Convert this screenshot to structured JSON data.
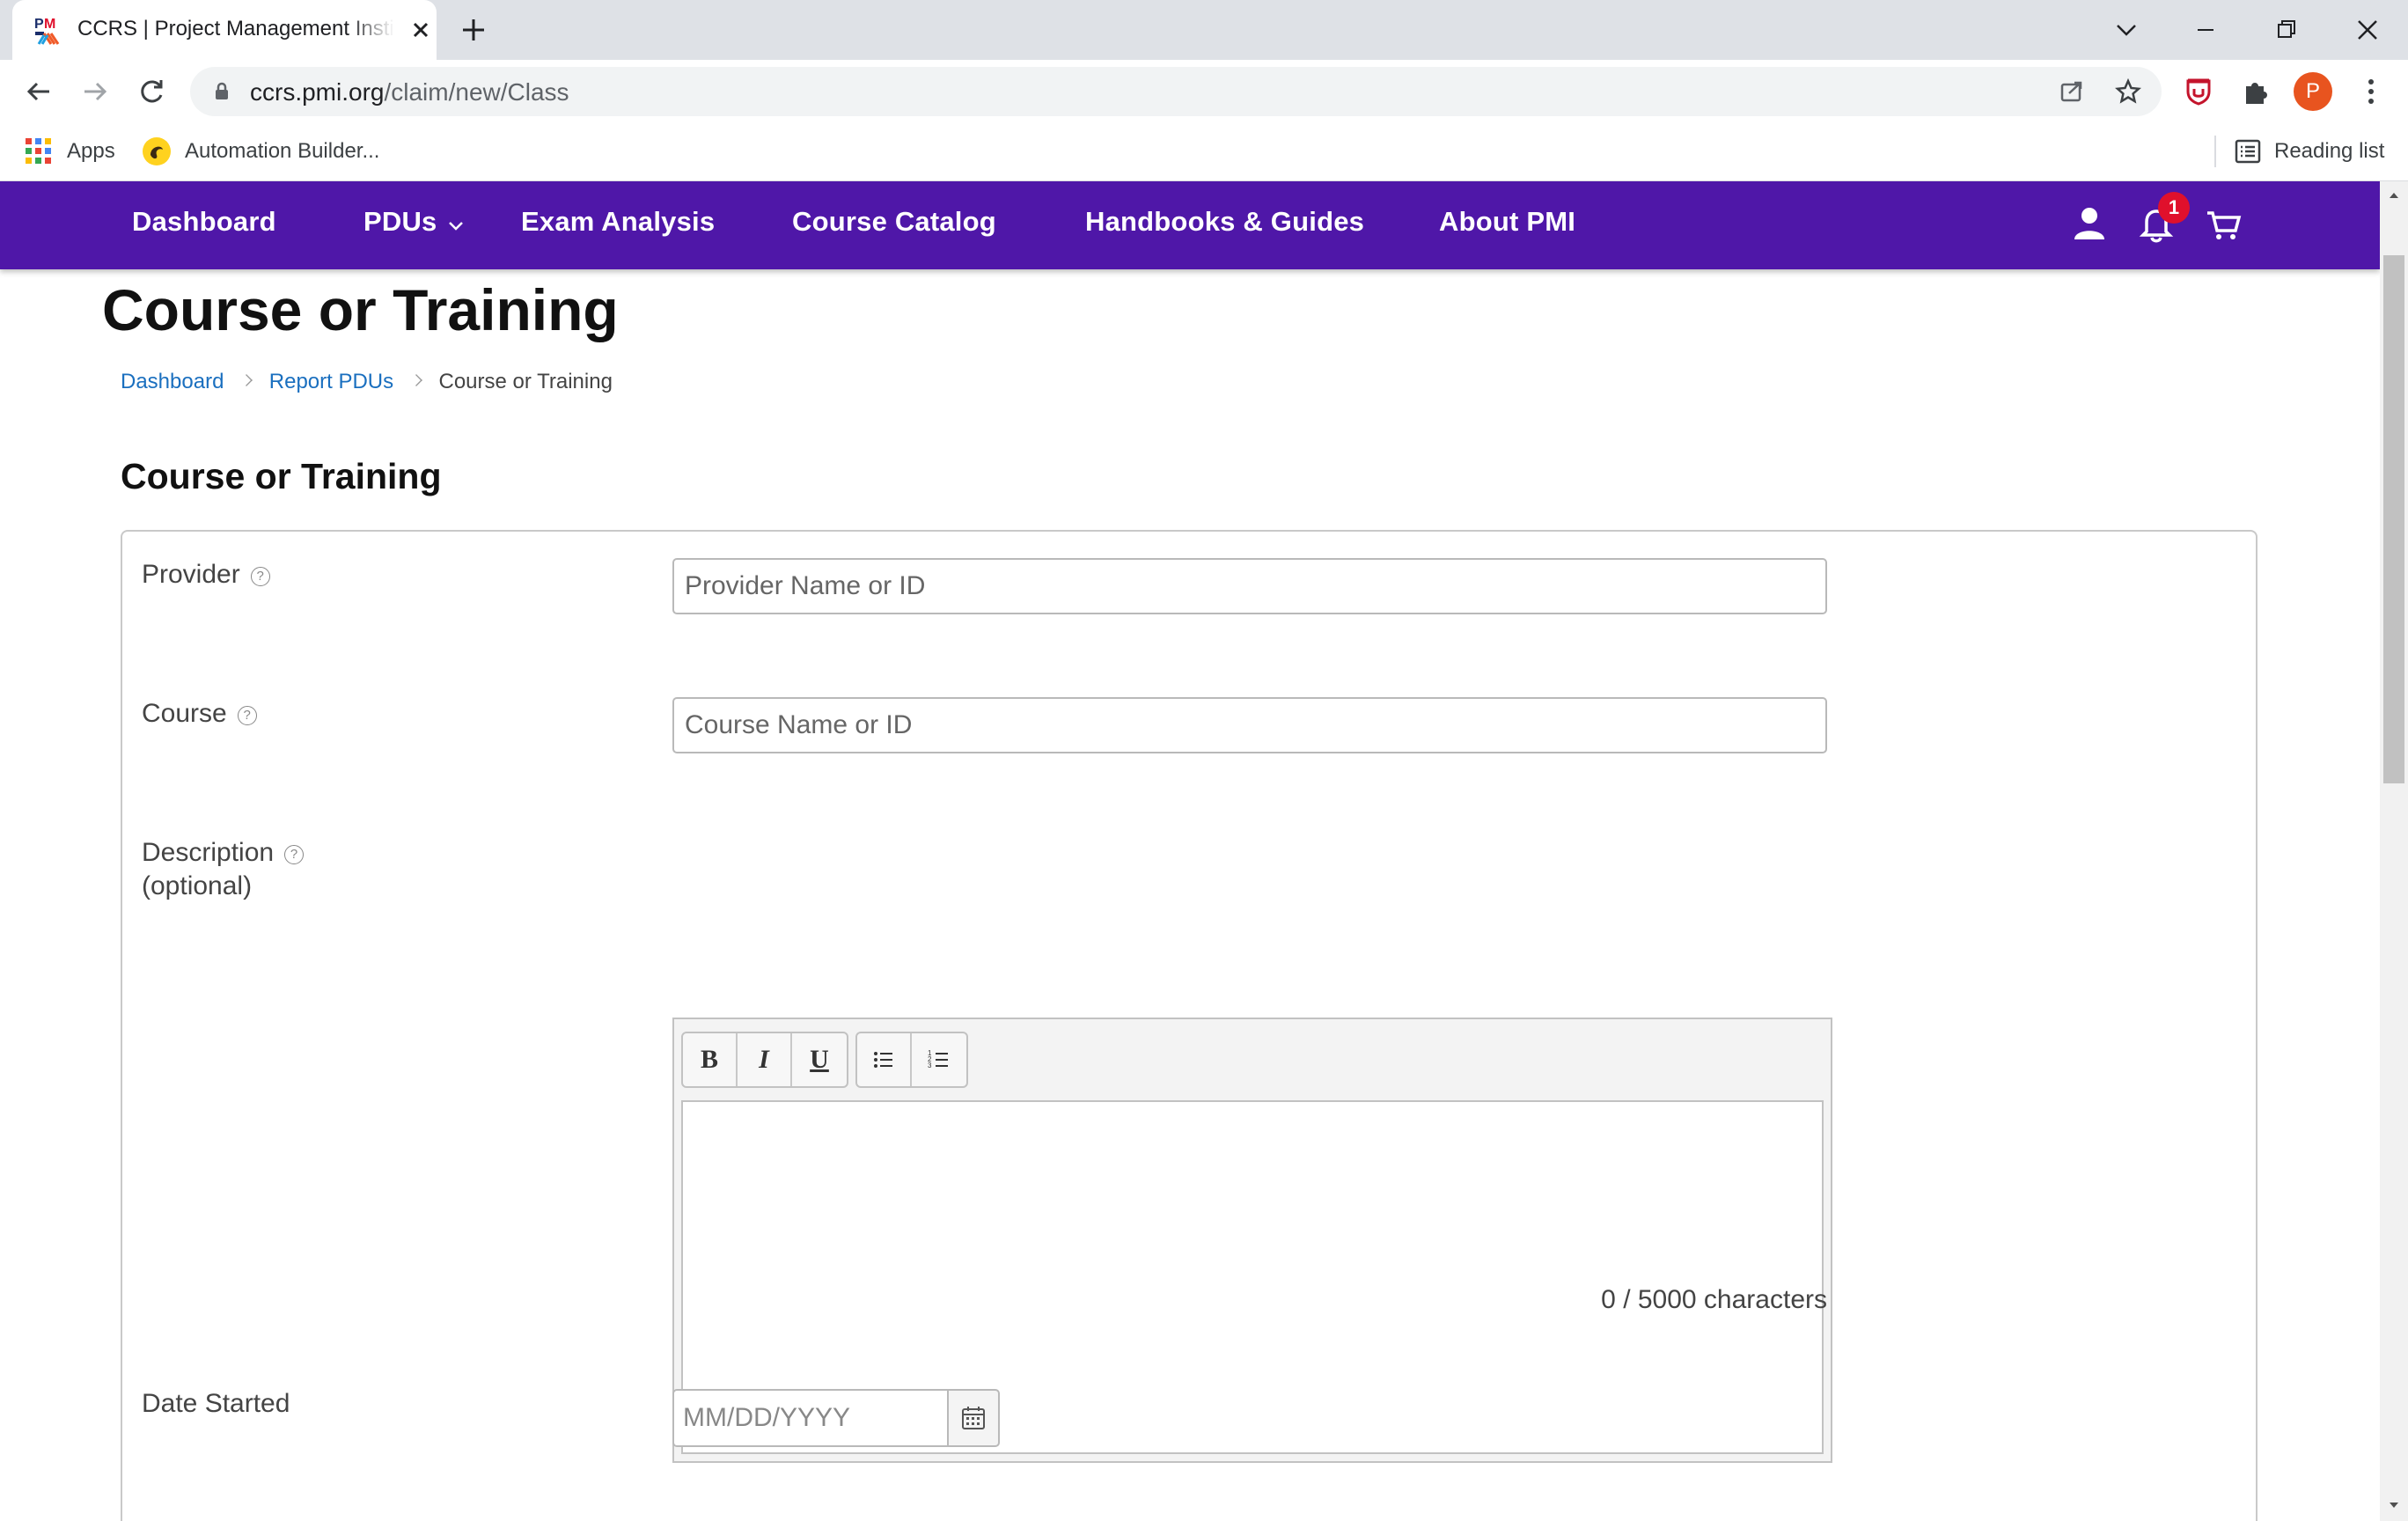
{
  "browser": {
    "tab_title": "CCRS | Project Management Institute",
    "url_domain": "ccrs.pmi.org",
    "url_path": "/claim/new/Class",
    "profile_initial": "P",
    "bookmarks": {
      "apps": "Apps",
      "automation": "Automation Builder...",
      "reading_list": "Reading list"
    }
  },
  "sitenav": {
    "items": [
      "Dashboard",
      "PDUs",
      "Exam Analysis",
      "Course Catalog",
      "Handbooks & Guides",
      "About PMI"
    ],
    "notification_count": "1",
    "brand_color": "#4f17a8"
  },
  "page": {
    "title": "Course or Training",
    "breadcrumb": [
      "Dashboard",
      "Report PDUs",
      "Course or Training"
    ],
    "section_title": "Course or Training"
  },
  "form": {
    "provider": {
      "label": "Provider",
      "help": "?",
      "placeholder": "Provider Name or ID"
    },
    "course": {
      "label": "Course",
      "help": "?",
      "placeholder": "Course Name or ID"
    },
    "description": {
      "label": "Description",
      "label_sub": "(optional)",
      "help": "?",
      "toolbar": {
        "bold": "B",
        "italic": "I",
        "underline": "U"
      },
      "char_count": "0 / 5000 characters"
    },
    "date_started": {
      "label": "Date Started",
      "placeholder": "MM/DD/YYYY"
    }
  }
}
